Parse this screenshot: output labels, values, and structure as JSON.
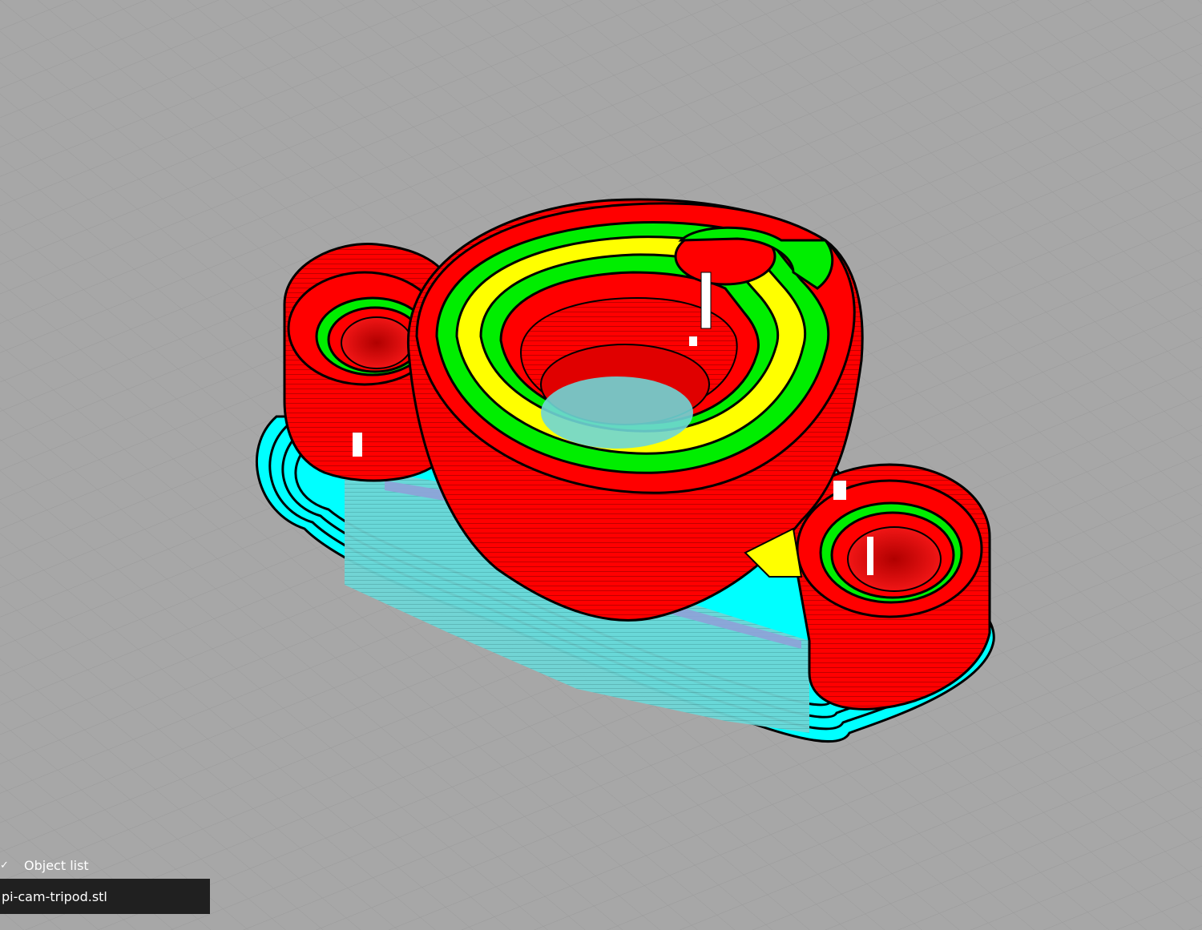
{
  "viewport": {
    "background_color": "#a7a7a7",
    "grid_color": "#999999",
    "colors": {
      "outer_wall": "#ff0000",
      "inner_wall": "#00ee00",
      "skin": "#ffff00",
      "support": "#00ffff",
      "infill": "#8fa2d8"
    }
  },
  "object_list": {
    "header_label": "Object list",
    "header_icon": "checkmark-icon",
    "items": [
      {
        "name": "pi-cam-tripod.stl"
      }
    ]
  }
}
